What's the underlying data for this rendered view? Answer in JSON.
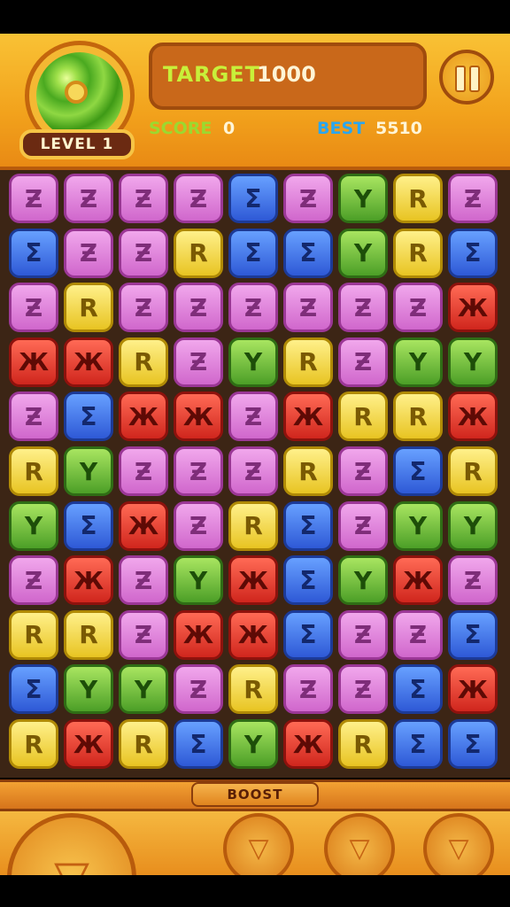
{
  "header": {
    "level_label": "LEVEL 1",
    "target_label": "TARGET",
    "target_value": "1000",
    "score_label": "SCORE",
    "score_value": "0",
    "best_label": "BEST",
    "best_value": "5510",
    "pause_icon": "pause-icon"
  },
  "board": {
    "rows": [
      [
        "purple",
        "purple",
        "purple",
        "purple",
        "blue",
        "purple",
        "green",
        "yellow",
        "purple"
      ],
      [
        "blue",
        "purple",
        "purple",
        "yellow",
        "blue",
        "blue",
        "green",
        "yellow",
        "blue"
      ],
      [
        "purple",
        "yellow",
        "purple",
        "purple",
        "purple",
        "purple",
        "purple",
        "purple",
        "red"
      ],
      [
        "red",
        "red",
        "yellow",
        "purple",
        "green",
        "yellow",
        "purple",
        "green",
        "green"
      ],
      [
        "purple",
        "blue",
        "red",
        "red",
        "purple",
        "red",
        "yellow",
        "yellow",
        "red"
      ],
      [
        "yellow",
        "green",
        "purple",
        "purple",
        "purple",
        "yellow",
        "purple",
        "blue",
        "yellow"
      ],
      [
        "green",
        "blue",
        "red",
        "purple",
        "yellow",
        "blue",
        "purple",
        "green",
        "green"
      ],
      [
        "purple",
        "red",
        "purple",
        "green",
        "red",
        "blue",
        "green",
        "red",
        "purple"
      ],
      [
        "yellow",
        "yellow",
        "purple",
        "red",
        "red",
        "blue",
        "purple",
        "purple",
        "blue"
      ],
      [
        "blue",
        "green",
        "green",
        "purple",
        "yellow",
        "purple",
        "purple",
        "blue",
        "red"
      ],
      [
        "yellow",
        "red",
        "yellow",
        "blue",
        "green",
        "red",
        "yellow",
        "blue",
        "blue"
      ]
    ],
    "glyphs": {
      "purple": "Ƶ",
      "blue": "Σ",
      "green": "Y",
      "yellow": "R",
      "red": "Ж"
    }
  },
  "boost": {
    "label": "BOOST"
  }
}
